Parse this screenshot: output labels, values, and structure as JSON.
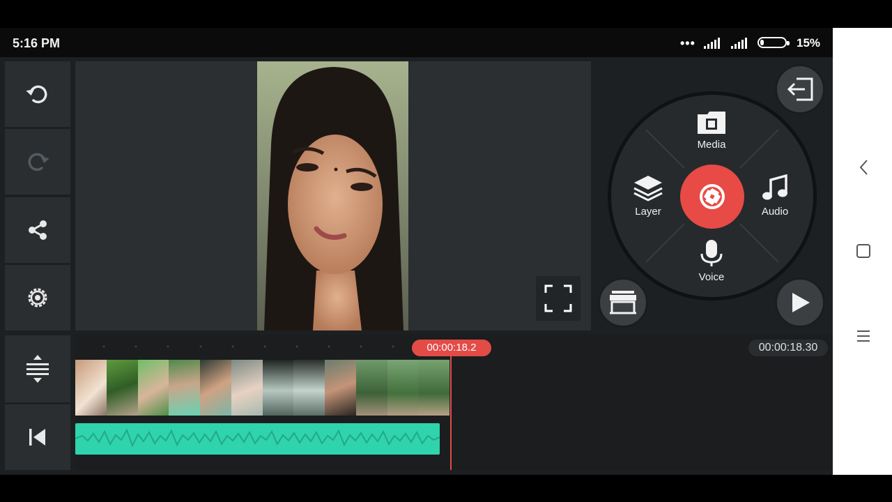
{
  "status": {
    "time": "5:16 PM",
    "dots": "•••",
    "battery_pct": "15%"
  },
  "preview": {
    "fullscreen_icon": "fullscreen-icon"
  },
  "toolbar": {
    "undo_icon": "undo-icon",
    "redo_icon": "redo-icon",
    "share_icon": "share-icon",
    "settings_icon": "settings-icon",
    "expand_icon": "expand-timeline-icon",
    "rewind_icon": "skip-to-start-icon"
  },
  "wheel": {
    "media_label": "Media",
    "layer_label": "Layer",
    "audio_label": "Audio",
    "voice_label": "Voice"
  },
  "timeline": {
    "current_time": "00:00:18.2",
    "total_time": "00:00:18.30"
  },
  "colors": {
    "accent_red": "#e84a46",
    "audio_teal": "#2fd3ac",
    "panel": "#2a2e31"
  }
}
